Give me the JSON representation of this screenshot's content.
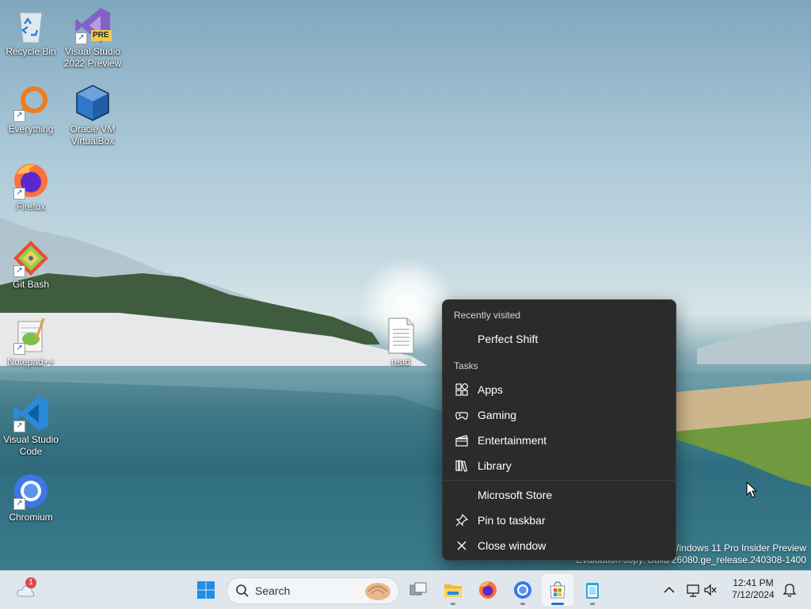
{
  "desktop": {
    "icons": [
      {
        "label": "Recycle Bin"
      },
      {
        "label": "Visual Studio 2022 Preview",
        "badge": "PRE"
      },
      {
        "label": "Everything"
      },
      {
        "label": "Oracle VM VirtualBox"
      },
      {
        "label": "Firefox"
      },
      {
        "label": "Git Bash"
      },
      {
        "label": "Notepad++"
      },
      {
        "label": "Visual Studio Code"
      },
      {
        "label": "Chromium"
      },
      {
        "label": "read"
      }
    ],
    "watermark": {
      "line1": "Windows 11 Pro Insider Preview",
      "line2": "Evaluation copy. Build 26080.ge_release.240308-1400"
    }
  },
  "jumplist": {
    "recent_header": "Recently visited",
    "recent_items": [
      {
        "label": "Perfect Shift"
      }
    ],
    "tasks_header": "Tasks",
    "tasks": [
      {
        "label": "Apps",
        "icon": "apps-icon"
      },
      {
        "label": "Gaming",
        "icon": "gamepad-icon"
      },
      {
        "label": "Entertainment",
        "icon": "clapperboard-icon"
      },
      {
        "label": "Library",
        "icon": "library-icon"
      }
    ],
    "app_name": "Microsoft Store",
    "pin_label": "Pin to taskbar",
    "close_label": "Close window"
  },
  "taskbar": {
    "weather_badge": "1",
    "search_placeholder": "Search",
    "clock_time": "12:41 PM",
    "clock_date": "7/12/2024",
    "accent": "#1e6fd9"
  }
}
